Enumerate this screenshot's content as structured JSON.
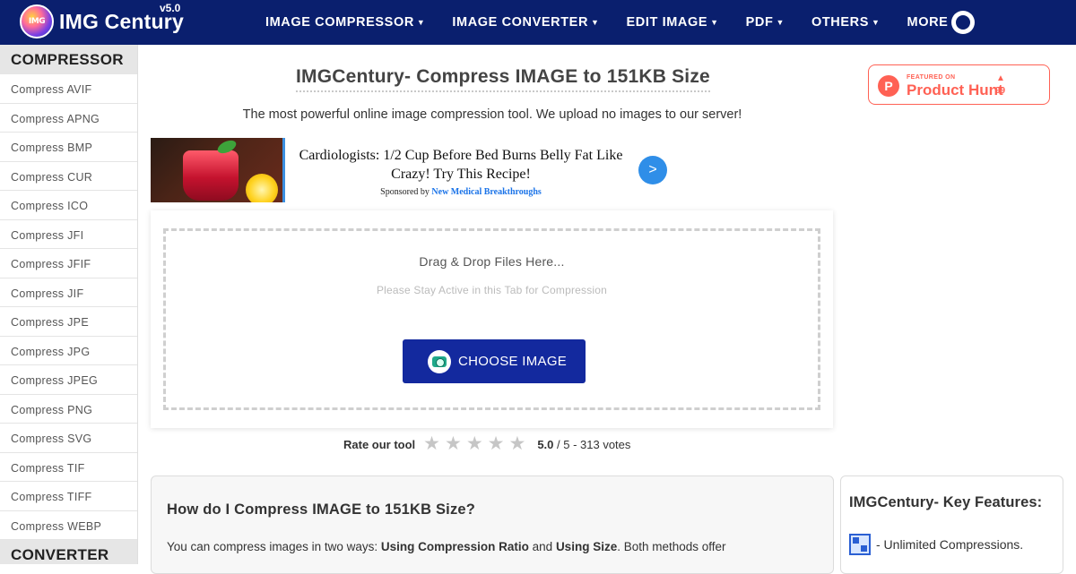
{
  "brand": {
    "name": "IMG Century",
    "version": "v5.0",
    "badge": "IMG"
  },
  "nav": {
    "items": [
      {
        "label": "IMAGE COMPRESSOR"
      },
      {
        "label": "IMAGE CONVERTER"
      },
      {
        "label": "EDIT IMAGE"
      },
      {
        "label": "PDF"
      },
      {
        "label": "OTHERS"
      },
      {
        "label": "MORE"
      }
    ],
    "dark_toggle_icon": "dark-mode-toggle-icon"
  },
  "sidebar": {
    "compressor_header": "COMPRESSOR",
    "items": [
      "Compress AVIF",
      "Compress APNG",
      "Compress BMP",
      "Compress CUR",
      "Compress ICO",
      "Compress JFI",
      "Compress JFIF",
      "Compress JIF",
      "Compress JPE",
      "Compress JPG",
      "Compress JPEG",
      "Compress PNG",
      "Compress SVG",
      "Compress TIF",
      "Compress TIFF",
      "Compress WEBP"
    ],
    "converter_header": "CONVERTER"
  },
  "page": {
    "title": "IMGCentury- Compress IMAGE to 151KB Size",
    "subtitle": "The most powerful online image compression tool. We upload no images to our server!"
  },
  "ad": {
    "headline": "Cardiologists: 1/2 Cup Before Bed Burns Belly Fat Like Crazy! Try This Recipe!",
    "sponsored_prefix": "Sponsored by",
    "sponsor": "New Medical Breakthroughs",
    "arrow": ">"
  },
  "upload": {
    "drop_text": "Drag & Drop Files Here...",
    "stay_text": "Please Stay Active in this Tab for Compression",
    "button_label": "CHOOSE IMAGE"
  },
  "rating": {
    "label": "Rate our tool",
    "stars_total": 5,
    "score": "5.0",
    "rest": "/ 5 - 313 votes"
  },
  "howto": {
    "title": "How do I Compress IMAGE to 151KB Size?",
    "text_a": "You can compress images in two ways: ",
    "text_b": "Using Compression Ratio",
    "text_c": " and ",
    "text_d": "Using Size",
    "text_e": ". Both methods offer"
  },
  "features": {
    "title": "IMGCentury- Key Features:",
    "item1": "- Unlimited Compressions."
  },
  "product_hunt": {
    "featured": "FEATURED ON",
    "name": "Product Hunt",
    "logo": "P",
    "arrow": "▲",
    "count": "99"
  },
  "colors": {
    "navbar": "#0a1f6e",
    "button": "#13299e",
    "product_hunt": "#ff6154",
    "ad_arrow": "#2f8ee8"
  }
}
